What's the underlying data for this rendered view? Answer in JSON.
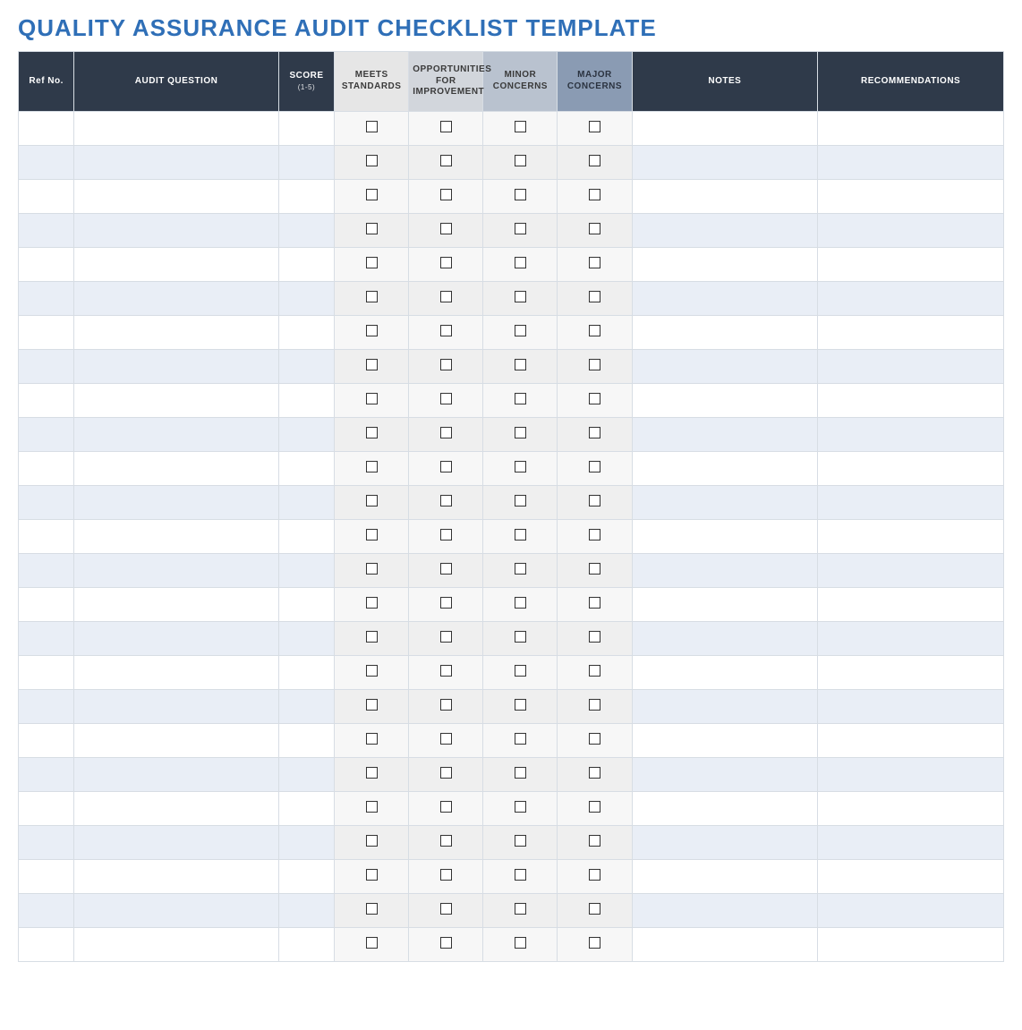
{
  "title": "QUALITY ASSURANCE AUDIT CHECKLIST TEMPLATE",
  "columns": {
    "ref": "Ref No.",
    "question": "AUDIT QUESTION",
    "score": "SCORE",
    "score_sub": "(1-5)",
    "meets": "MEETS STANDARDS",
    "opp": "OPPORTUNITIES FOR IMPROVEMENT",
    "minor": "MINOR CONCERNS",
    "major": "MAJOR CONCERNS",
    "notes": "NOTES",
    "recs": "RECOMMENDATIONS"
  },
  "row_count": 25,
  "rows": []
}
